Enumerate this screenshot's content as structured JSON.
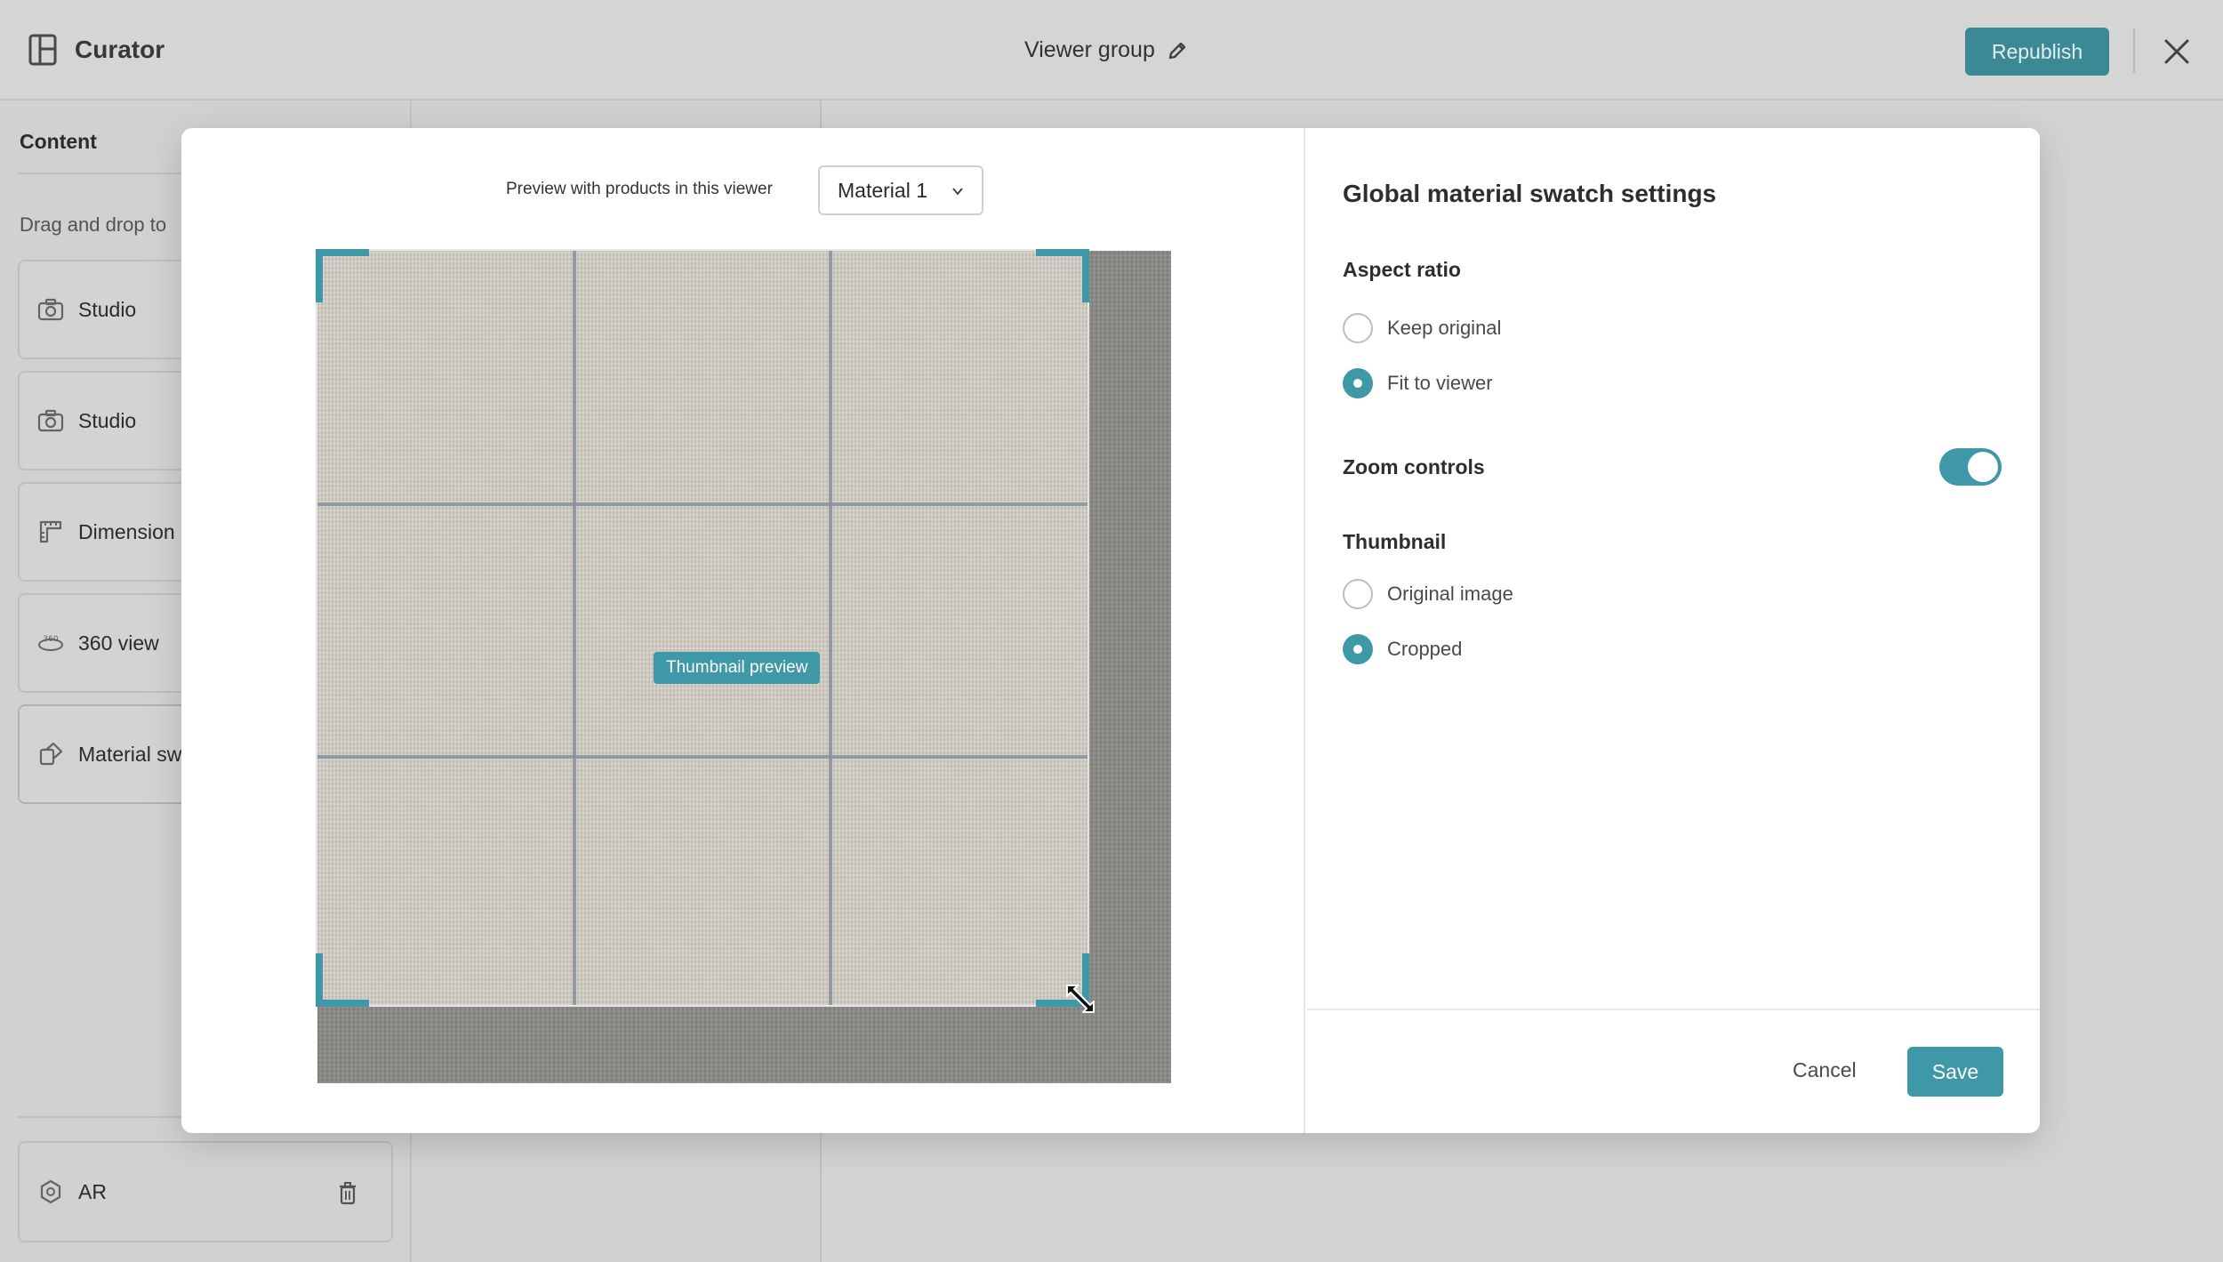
{
  "header": {
    "app_name": "Curator",
    "group_title": "Viewer group",
    "republish_label": "Republish"
  },
  "sidebar": {
    "heading": "Content",
    "drag_hint": "Drag and drop to",
    "items": [
      {
        "label": "Studio",
        "icon": "camera-icon"
      },
      {
        "label": "Studio",
        "icon": "camera-icon"
      },
      {
        "label": "Dimension",
        "icon": "ruler-icon"
      },
      {
        "label": "360 view",
        "icon": "360-icon"
      },
      {
        "label": "Material sw",
        "icon": "swatch-icon"
      }
    ],
    "ar_label": "AR"
  },
  "modal": {
    "preview_label": "Preview with products in this viewer",
    "material_select": "Material 1",
    "thumbnail_label": "Thumbnail preview",
    "settings": {
      "title": "Global material swatch settings",
      "aspect_ratio_label": "Aspect ratio",
      "aspect_options": [
        "Keep original",
        "Fit to viewer"
      ],
      "aspect_selected": "Fit to viewer",
      "zoom_controls_label": "Zoom controls",
      "zoom_controls_on": true,
      "thumbnail_label": "Thumbnail",
      "thumbnail_options": [
        "Original image",
        "Cropped"
      ],
      "thumbnail_selected": "Cropped"
    },
    "cancel_label": "Cancel",
    "save_label": "Save"
  },
  "colors": {
    "accent": "#3e98a8",
    "republish": "#3c8c98"
  }
}
